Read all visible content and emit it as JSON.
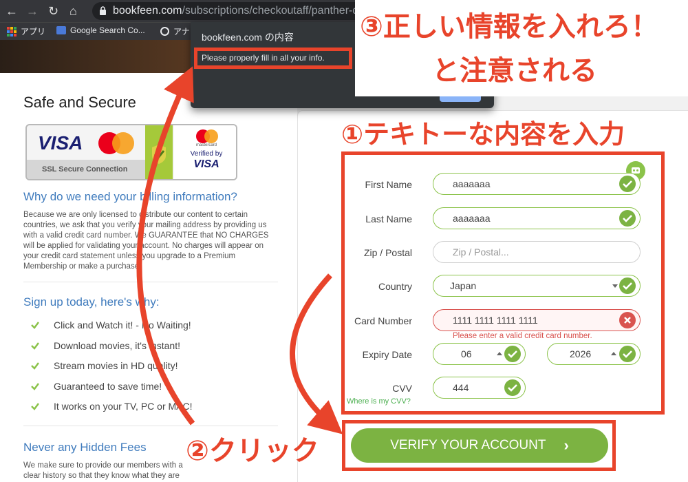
{
  "browser": {
    "url_domain": "bookfeen.com",
    "url_path": "/subscriptions/checkoutaff/panther-dire",
    "bookmarks": [
      "アプリ",
      "Google Search Co...",
      "アナ"
    ]
  },
  "dialog": {
    "title": "bookfeen.com の内容",
    "message": "Please properly fill in all your info."
  },
  "left": {
    "title": "Safe and Secure",
    "badge": {
      "visa": "VISA",
      "ssl": "SSL Secure Connection",
      "mastercard": "mastercard",
      "verified_by": "Verified by",
      "visa2": "VISA"
    },
    "why_heading": "Why do we need your billing information?",
    "why_text": "Because we are only licensed to distribute our content to certain countries, we ask that you verify your mailing address by providing us with a valid credit card number. We GUARANTEE that NO CHARGES will be applied for validating your account. No charges will appear on your credit card statement unless you upgrade to a Premium Membership or make a purchase.",
    "signup_heading": "Sign up today, here's why:",
    "benefits": [
      "Click and Watch it! - No Waiting!",
      "Download movies, it's instant!",
      "Stream movies in HD quality!",
      "Guaranteed to save time!",
      "It works on your TV, PC or MAC!"
    ],
    "fees_heading": "Never any Hidden Fees",
    "fees_text": "We make sure to provide our members with a clear history so that they know what they are paying for. Credit card"
  },
  "form": {
    "first_name": {
      "label": "First Name",
      "value": "aaaaaaa"
    },
    "last_name": {
      "label": "Last Name",
      "value": "aaaaaaa"
    },
    "zip": {
      "label": "Zip / Postal",
      "placeholder": "Zip / Postal..."
    },
    "country": {
      "label": "Country",
      "value": "Japan"
    },
    "card_number": {
      "label": "Card Number",
      "value": "1111 1111 1111 1111",
      "error": "Please enter a valid credit card number."
    },
    "expiry": {
      "label": "Expiry Date",
      "month": "06",
      "year": "2026"
    },
    "cvv": {
      "label": "CVV",
      "value": "444",
      "help": "Where is my CVV?"
    },
    "submit": "VERIFY YOUR ACCOUNT"
  },
  "annotations": {
    "note3_line1": "③正しい情報を入れろ！",
    "note3_line2": "と注意される",
    "note1": "①テキトーな内容を入力",
    "note2": "②クリック"
  },
  "colors": {
    "annotation_red": "#e8442b",
    "valid_green": "#8bc34a",
    "button_green": "#7cb342",
    "error_red": "#d9534f",
    "heading_blue": "#3f7bbd"
  }
}
